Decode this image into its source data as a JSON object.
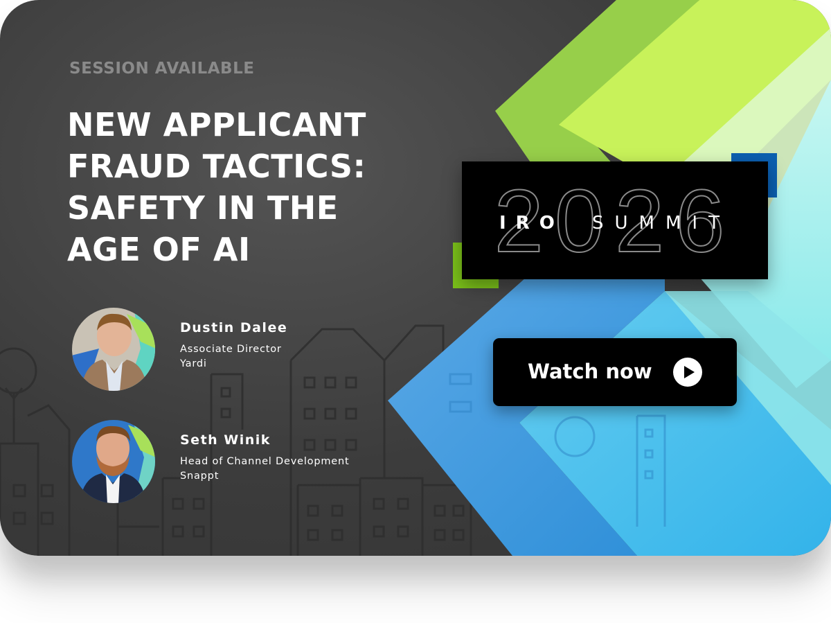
{
  "eyebrow": "SESSION AVAILABLE",
  "title": "NEW APPLICANT FRAUD TACTICS: SAFETY IN THE AGE OF AI",
  "speakers": [
    {
      "name": "Dustin Dalee",
      "role": "Associate Director",
      "org": "Yardi"
    },
    {
      "name": "Seth Winik",
      "role": "Head of Channel Development",
      "org": "Snappt"
    }
  ],
  "logo": {
    "year": "2026",
    "brand": "IRO",
    "event": "SUMMIT"
  },
  "cta": {
    "label": "Watch now",
    "icon": "play-icon"
  },
  "colors": {
    "background": "#3c3c3c",
    "lime": "#c8f25a",
    "green": "#7cc21a",
    "blue": "#2f9ee6",
    "cyan": "#9ff0ee",
    "navy": "#0b5fb0"
  }
}
